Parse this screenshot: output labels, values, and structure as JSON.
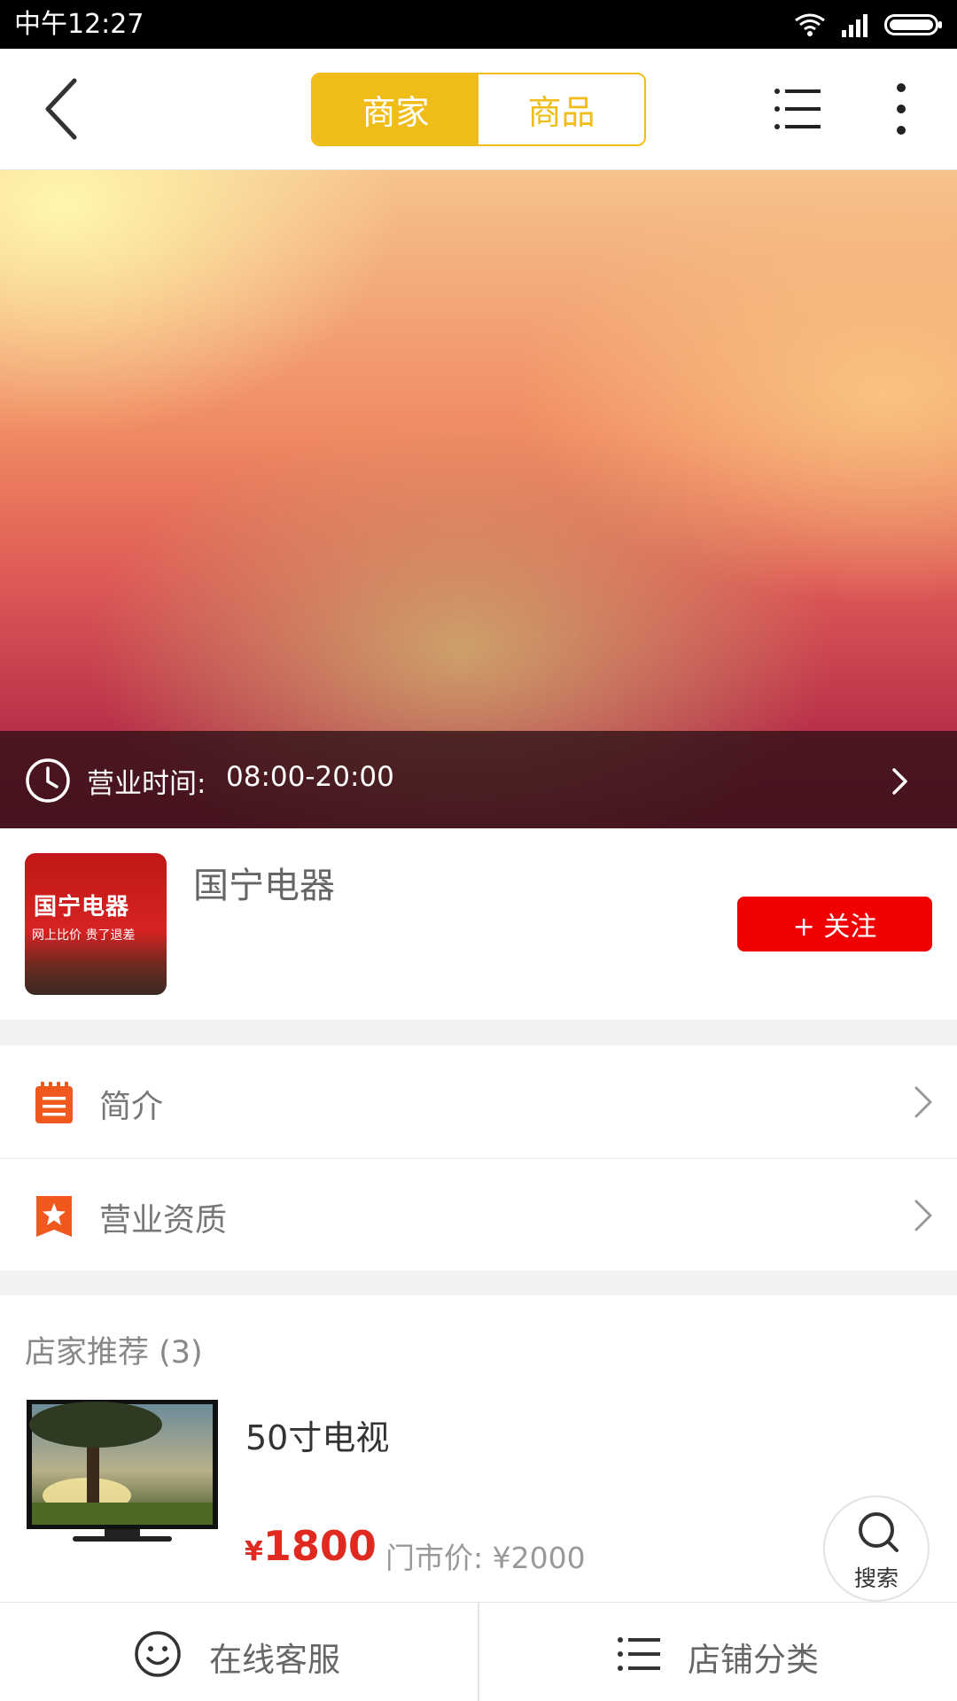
{
  "status_bar": {
    "time": "中午12:27"
  },
  "nav": {
    "tabs": [
      {
        "label": "商家",
        "active": true
      },
      {
        "label": "商品",
        "active": false
      }
    ]
  },
  "banner": {
    "hours_label": "营业时间:",
    "hours_value": "08:00-20:00"
  },
  "shop": {
    "name": "国宁电器",
    "logo_sign": "国宁电器",
    "logo_slogan": "网上比价 贵了退差",
    "follow_label": "+ 关注"
  },
  "menu": {
    "items": [
      {
        "label": "简介",
        "icon": "notepad-icon"
      },
      {
        "label": "营业资质",
        "icon": "star-badge-icon"
      }
    ]
  },
  "recommend": {
    "title": "店家推荐 (3)",
    "product": {
      "name": "50寸电视",
      "currency": "¥",
      "price": "1800",
      "market_price": "门市价: ¥2000"
    }
  },
  "search_fab": {
    "label": "搜索"
  },
  "bottom_bar": {
    "service_label": "在线客服",
    "category_label": "店铺分类"
  },
  "colors": {
    "accent_yellow": "#f0bd18",
    "follow_red": "#f00000",
    "price_red": "#e12a1f",
    "icon_orange": "#f0581e"
  }
}
